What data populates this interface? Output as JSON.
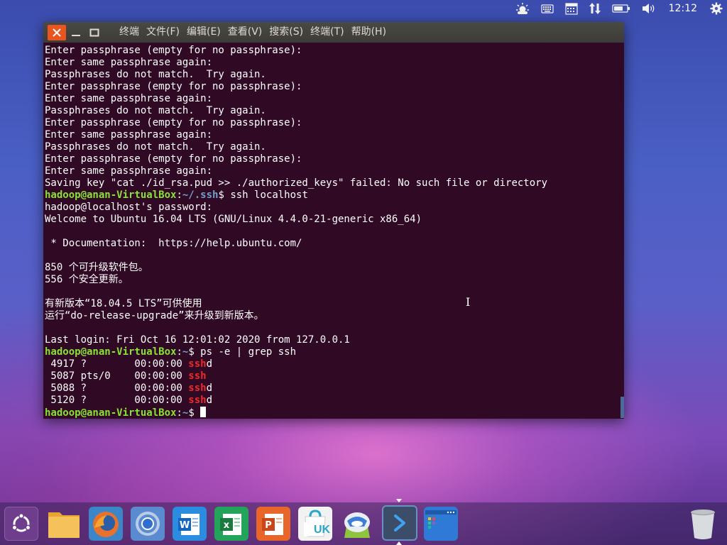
{
  "top_panel": {
    "clock": "12:12",
    "icons": [
      "weather-icon",
      "keyboard-icon",
      "calendar-icon",
      "network-icon",
      "battery-icon",
      "volume-icon",
      "settings-gear-icon"
    ]
  },
  "window": {
    "menu": [
      "终端",
      "文件(F)",
      "编辑(E)",
      "查看(V)",
      "搜索(S)",
      "终端(T)",
      "帮助(H)"
    ]
  },
  "terminal": {
    "lines": [
      "Enter passphrase (empty for no passphrase):",
      "Enter same passphrase again:",
      "Passphrases do not match.  Try again.",
      "Enter passphrase (empty for no passphrase):",
      "Enter same passphrase again:",
      "Passphrases do not match.  Try again.",
      "Enter passphrase (empty for no passphrase):",
      "Enter same passphrase again:",
      "Passphrases do not match.  Try again.",
      "Enter passphrase (empty for no passphrase):",
      "Enter same passphrase again:",
      "Saving key \"cat ./id_rsa.pud >> ./authorized_keys\" failed: No such file or directory"
    ],
    "prompt1": {
      "user": "hadoop@anan-VirtualBox",
      "colon": ":",
      "path": "~/.ssh",
      "dollar": "$ ",
      "command": "ssh localhost"
    },
    "login_lines": [
      "hadoop@localhost's password:",
      "Welcome to Ubuntu 16.04 LTS (GNU/Linux 4.4.0-21-generic x86_64)",
      "",
      " * Documentation:  https://help.ubuntu.com/",
      "",
      "850 个可升级软件包。",
      "556 个安全更新。",
      "",
      "有新版本“18.04.5 LTS”可供使用",
      "运行“do-release-upgrade”来升级到新版本。",
      "",
      "Last login: Fri Oct 16 12:01:02 2020 from 127.0.0.1"
    ],
    "prompt2": {
      "user": "hadoop@anan-VirtualBox",
      "colon": ":",
      "path": "~",
      "dollar": "$ ",
      "command": "ps -e | grep ssh"
    },
    "ps_rows": [
      {
        "prefix": " 4917 ?        00:00:00 ",
        "match": "ssh",
        "suffix": "d"
      },
      {
        "prefix": " 5087 pts/0    00:00:00 ",
        "match": "ssh",
        "suffix": ""
      },
      {
        "prefix": " 5088 ?        00:00:00 ",
        "match": "ssh",
        "suffix": "d"
      },
      {
        "prefix": " 5120 ?        00:00:00 ",
        "match": "ssh",
        "suffix": "d"
      }
    ],
    "prompt3": {
      "user": "hadoop@anan-VirtualBox",
      "colon": ":",
      "path": "~",
      "dollar": "$ "
    }
  },
  "dock": {
    "items": [
      "ubuntu-launcher-icon",
      "files-icon",
      "firefox-icon",
      "chromium-icon",
      "wps-writer-icon",
      "wps-spreadsheets-icon",
      "wps-presentation-icon",
      "software-center-icon",
      "kylin-assistant-icon",
      "terminal-icon",
      "workspace-switcher-icon",
      "trash-icon"
    ],
    "software_center_badge": "UK"
  },
  "colors": {
    "terminal_bg": "#300a24",
    "prompt_user": "#8ae234",
    "prompt_path": "#729fcf",
    "grep_match": "#ef2929",
    "close_button": "#e9541f"
  }
}
